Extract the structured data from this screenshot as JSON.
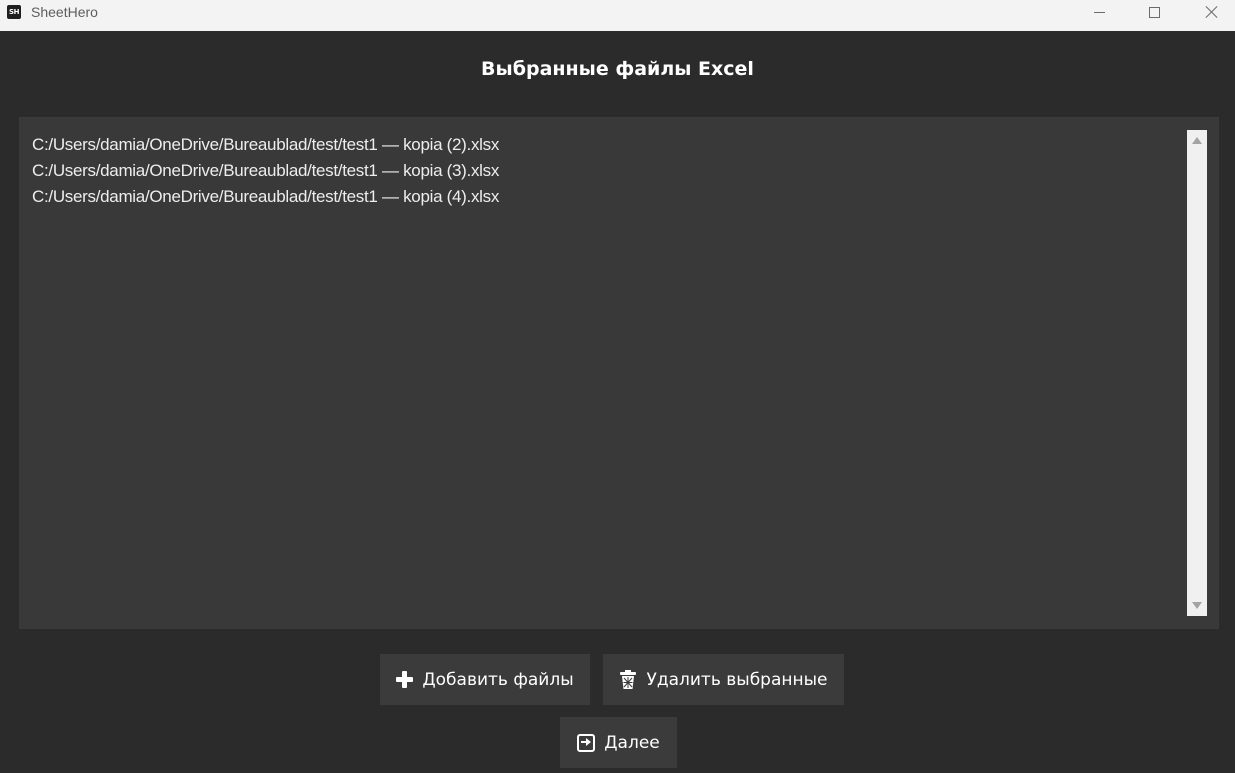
{
  "window": {
    "app_icon_text": "SH",
    "title": "SheetHero"
  },
  "main": {
    "heading": "Выбранные файлы Excel",
    "files": [
      "C:/Users/damia/OneDrive/Bureaublad/test/test1 — kopia (2).xlsx",
      "C:/Users/damia/OneDrive/Bureaublad/test/test1 — kopia (3).xlsx",
      "C:/Users/damia/OneDrive/Bureaublad/test/test1 — kopia (4).xlsx"
    ]
  },
  "buttons": {
    "add_label": "Добавить файлы",
    "delete_label": "Удалить выбранные",
    "next_label": "Далее"
  },
  "icons": {
    "add": "plus-icon",
    "delete": "trash-icon",
    "next": "arrow-right-box-icon"
  },
  "colors": {
    "background": "#2b2b2b",
    "listbox": "#393939",
    "button": "#3b3b3b",
    "text": "#ffffff"
  }
}
